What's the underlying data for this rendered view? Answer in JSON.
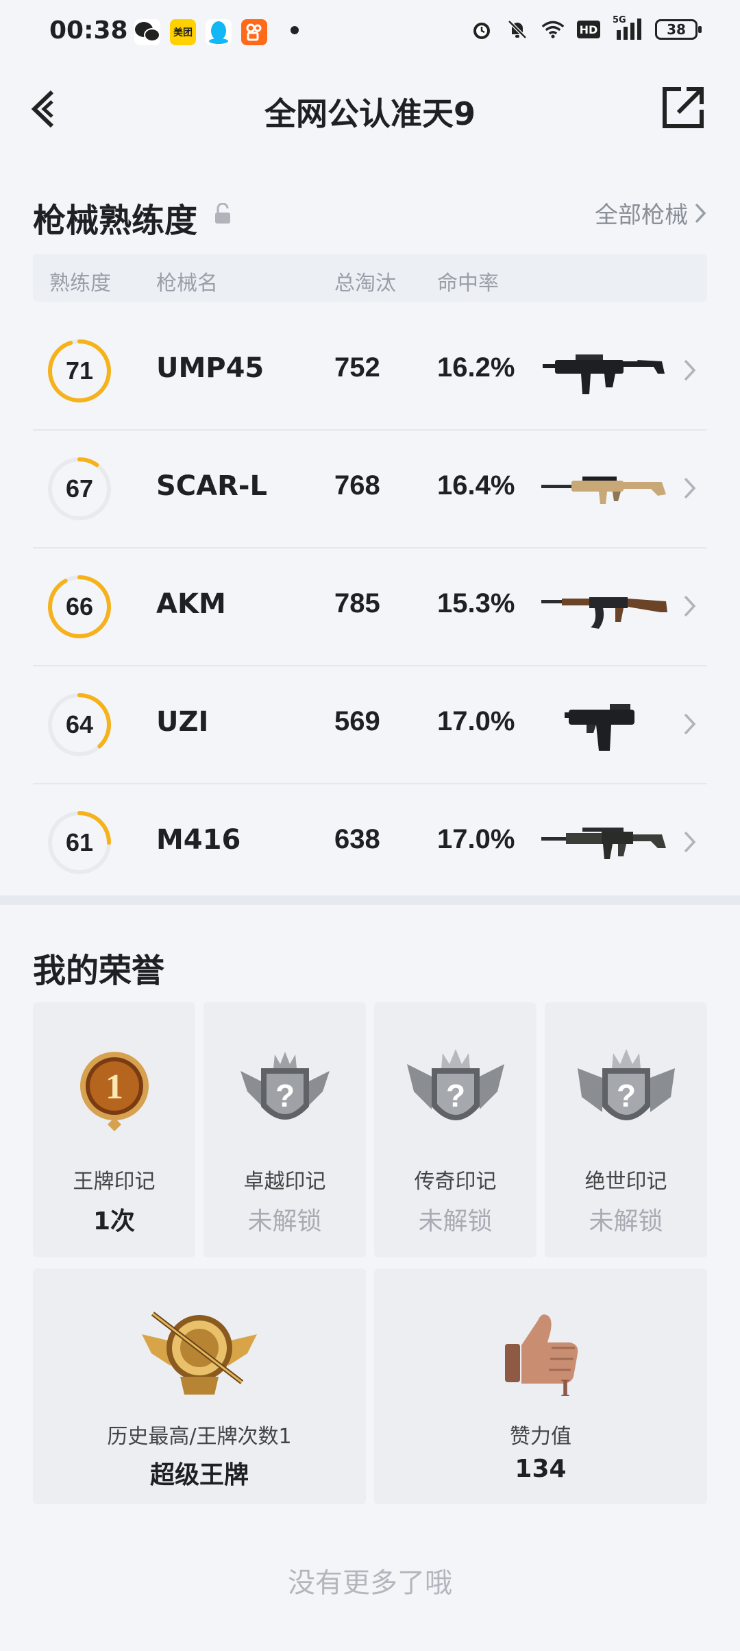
{
  "status_bar": {
    "time": "00:38",
    "apps": [
      "wechat-icon",
      "meituan-icon",
      "qq-icon",
      "kuaishou-icon"
    ],
    "meituan_label": "美团",
    "network": "5G",
    "hd_label": "HD",
    "battery": "38"
  },
  "header": {
    "title": "全网公认准天9"
  },
  "weapons": {
    "title": "枪械熟练度",
    "all_link": "全部枪械",
    "columns": {
      "proficiency": "熟练度",
      "name": "枪械名",
      "kills": "总淘汰",
      "hit_rate": "命中率"
    },
    "rows": [
      {
        "proficiency": "71",
        "progress": 0.95,
        "name": "UMP45",
        "kills": "752",
        "hit_rate": "16.2%"
      },
      {
        "proficiency": "67",
        "progress": 0.1,
        "name": "SCAR-L",
        "kills": "768",
        "hit_rate": "16.4%"
      },
      {
        "proficiency": "66",
        "progress": 0.92,
        "name": "AKM",
        "kills": "785",
        "hit_rate": "15.3%"
      },
      {
        "proficiency": "64",
        "progress": 0.38,
        "name": "UZI",
        "kills": "569",
        "hit_rate": "17.0%"
      },
      {
        "proficiency": "61",
        "progress": 0.25,
        "name": "M416",
        "kills": "638",
        "hit_rate": "17.0%"
      }
    ]
  },
  "honors": {
    "title": "我的荣誉",
    "marks": [
      {
        "name": "王牌印记",
        "value": "1次",
        "badge_number": "1"
      },
      {
        "name": "卓越印记",
        "value": "未解锁",
        "badge_glyph": "?"
      },
      {
        "name": "传奇印记",
        "value": "未解锁",
        "badge_glyph": "?"
      },
      {
        "name": "绝世印记",
        "value": "未解锁",
        "badge_glyph": "?"
      }
    ],
    "stats": [
      {
        "label": "历史最高/王牌次数1",
        "value": "超级王牌"
      },
      {
        "label": "赞力值",
        "value": "134",
        "badge_glyph": "I"
      }
    ]
  },
  "footer": {
    "note": "没有更多了哦"
  },
  "colors": {
    "ring_progress": "#f5b21a",
    "ring_track": "#e8eaee",
    "background": "#f3f5f9"
  }
}
